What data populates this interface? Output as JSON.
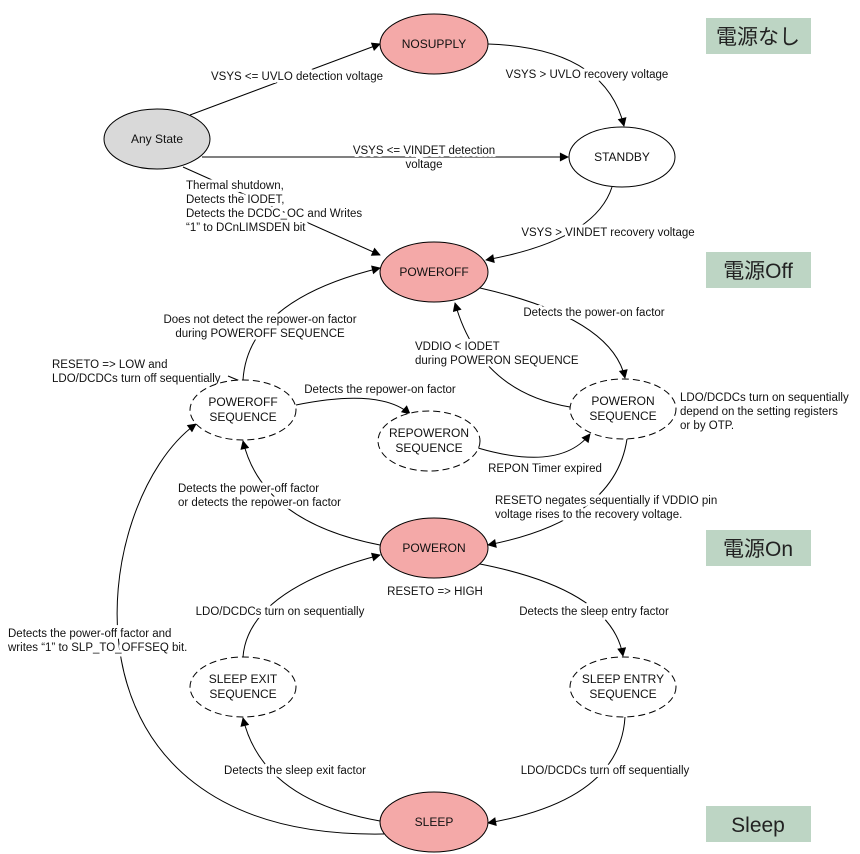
{
  "colors": {
    "power_state_fill": "#f4a9a8",
    "any_state_fill": "#d9d9d9",
    "sequence_fill": "#ffffff",
    "zone_label_bg": "#bdd5c4"
  },
  "zones": [
    "電源なし",
    "電源Off",
    "電源On",
    "Sleep"
  ],
  "nodes": {
    "nosupply": [
      "NOSUPPLY"
    ],
    "any_state": [
      "Any State"
    ],
    "standby": [
      "STANDBY"
    ],
    "poweroff": [
      "POWEROFF"
    ],
    "poweroff_seq": [
      "POWEROFF",
      "SEQUENCE"
    ],
    "repoweron_seq": [
      "REPOWERON",
      "SEQUENCE"
    ],
    "poweron_seq": [
      "POWERON",
      "SEQUENCE"
    ],
    "poweron": [
      "POWERON"
    ],
    "sleep_exit_seq": [
      "SLEEP EXIT",
      "SEQUENCE"
    ],
    "sleep_entry_seq": [
      "SLEEP ENTRY",
      "SEQUENCE"
    ],
    "sleep": [
      "SLEEP"
    ]
  },
  "edges": {
    "any_to_nosupply": [
      "VSYS <= UVLO detection voltage"
    ],
    "nosupply_to_standby": [
      "VSYS > UVLO recovery voltage"
    ],
    "any_to_standby": [
      "VSYS <= VINDET detection",
      "voltage"
    ],
    "any_to_poweroff": [
      "Thermal shutdown,",
      "Detects the IODET,",
      "Detects the DCDC_OC and Writes",
      "“1” to   DCnLIMSDEN bit"
    ],
    "standby_to_poweroff": [
      "VSYS > VINDET recovery voltage"
    ],
    "poweroff_to_poweron_seq": [
      "Detects the power-on factor"
    ],
    "poweron_seq_to_poweroff": [
      "VDDIO < IODET",
      "during POWERON SEQUENCE"
    ],
    "poweroff_seq_to_poweroff": [
      "Does not detect the repower-on factor",
      "during POWEROFF SEQUENCE"
    ],
    "poweroff_seq_to_repoweron": [
      "Detects the repower-on factor"
    ],
    "repoweron_to_poweron_seq": [
      "REPON Timer expired"
    ],
    "poweron_seq_to_poweron": [
      "RESETO negates sequentially if VDDIO pin",
      "voltage rises to the recovery voltage."
    ],
    "poweron_to_poweroff_seq": [
      "Detects the power-off factor",
      "or detects the repower-on factor"
    ],
    "sleep_exit_to_poweron": [
      "LDO/DCDCs turn on sequentially"
    ],
    "poweron_to_sleep_entry": [
      "Detects the sleep entry factor"
    ],
    "sleep_entry_to_sleep": [
      "LDO/DCDCs turn off sequentially"
    ],
    "sleep_to_sleep_exit": [
      "Detects the sleep exit factor"
    ],
    "sleep_to_poweroff_seq": [
      "Detects the power-off factor and",
      "writes “1” to SLP_TO_OFFSEQ bit."
    ]
  },
  "annotations": {
    "poweroff_seq": [
      "RESETO => LOW and",
      "LDO/DCDCs turn off  sequentially"
    ],
    "poweron_seq": [
      "LDO/DCDCs turn on sequentially",
      "depend on the setting registers",
      "or by OTP."
    ],
    "poweron": [
      "RESETO => HIGH"
    ]
  }
}
